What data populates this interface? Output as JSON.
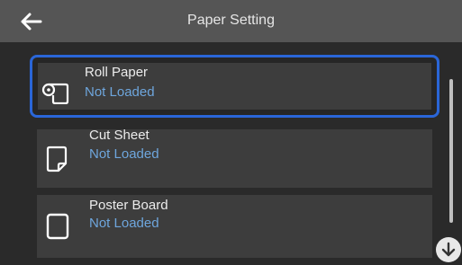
{
  "header": {
    "title": "Paper Setting",
    "back_icon": "arrow-left-icon"
  },
  "items": [
    {
      "name": "Roll Paper",
      "status": "Not Loaded",
      "icon": "roll-paper-icon",
      "selected": true
    },
    {
      "name": "Cut Sheet",
      "status": "Not Loaded",
      "icon": "cut-sheet-icon",
      "selected": false
    },
    {
      "name": "Poster Board",
      "status": "Not Loaded",
      "icon": "poster-board-icon",
      "selected": false
    }
  ],
  "scroll": {
    "down_icon": "arrow-down-icon"
  },
  "colors": {
    "header_bg": "#555555",
    "item_bg": "#3d3d3d",
    "selection_border": "#2a66d8",
    "status_text": "#6ea6dd"
  }
}
